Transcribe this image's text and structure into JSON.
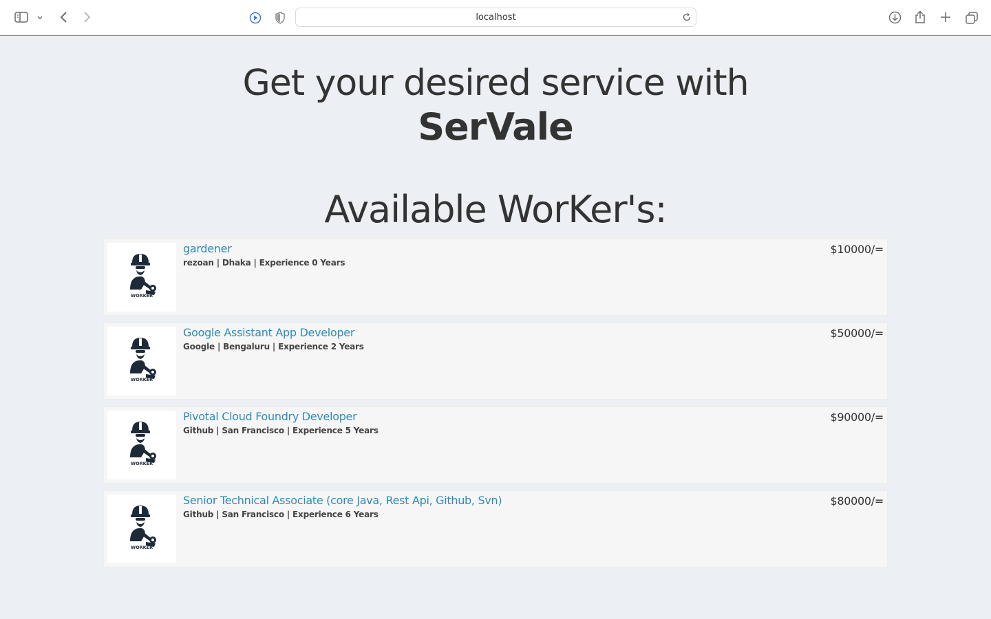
{
  "browser": {
    "url": "localhost"
  },
  "hero": {
    "line1": "Get your desired service with",
    "brand": "SerVale"
  },
  "section": {
    "title": "Available WorKer's:"
  },
  "workers": [
    {
      "title": "gardener",
      "meta": "rezoan | Dhaka | Experience 0 Years",
      "price": "$10000/=",
      "logo_text": "WORKER"
    },
    {
      "title": "Google Assistant App Developer",
      "meta": "Google | Bengaluru | Experience 2 Years",
      "price": "$50000/=",
      "logo_text": "WORKER"
    },
    {
      "title": "Pivotal Cloud Foundry Developer",
      "meta": "Github | San Francisco | Experience 5 Years",
      "price": "$90000/=",
      "logo_text": "WORKER"
    },
    {
      "title": "Senior Technical Associate (core Java, Rest Api, Github, Svn)",
      "meta": "Github | San Francisco | Experience 6 Years",
      "price": "$80000/=",
      "logo_text": "WORKER"
    }
  ],
  "icons": {
    "sidebar": "sidebar-icon",
    "back": "chevron-left-icon",
    "forward": "chevron-right-icon",
    "downloads": "download-icon",
    "share": "share-icon",
    "new_tab": "plus-icon",
    "tabs": "tabs-overview-icon"
  }
}
